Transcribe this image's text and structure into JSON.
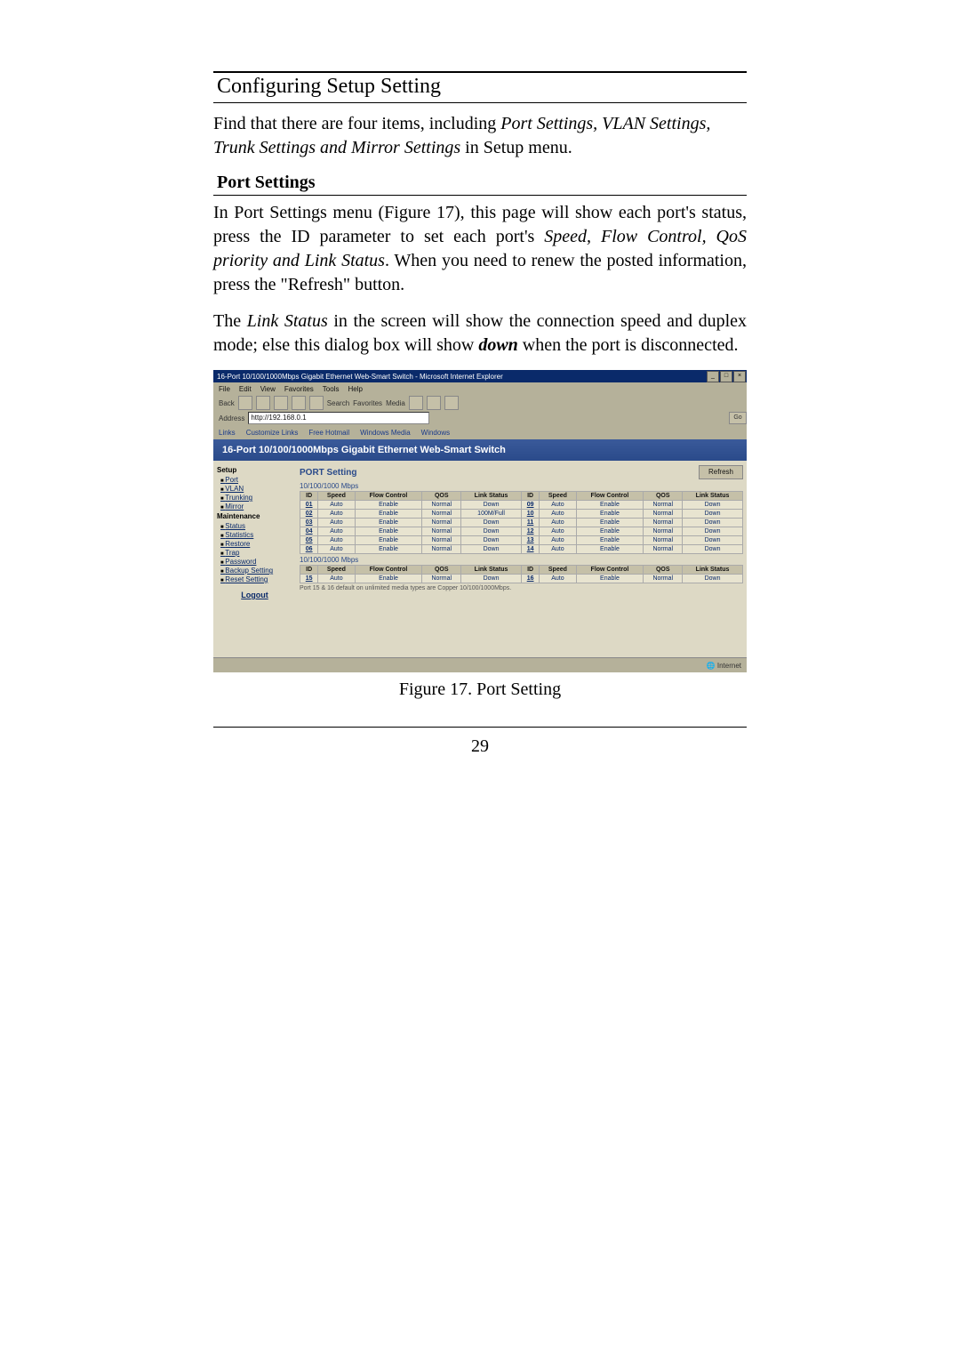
{
  "heading": "Configuring Setup Setting",
  "intro_pre": "Find that there are four items, including ",
  "intro_em": "Port Settings, VLAN Settings, Trunk Settings and Mirror Settings",
  "intro_post": " in Setup menu.",
  "subheading": "Port Settings",
  "para1_a": "In Port Settings menu (Figure 17), this page will show each port's status, press the ID parameter to set each port's ",
  "para1_em": "Speed, Flow Control, QoS priority and Link Status",
  "para1_b": ". When you need to renew the posted information, press the \"Refresh\" button.",
  "para2_a": "The ",
  "para2_em1": "Link Status",
  "para2_b": " in the screen will show the connection speed and duplex mode; else this dialog box will show ",
  "para2_em2": "down",
  "para2_c": " when the port is disconnected.",
  "caption": "Figure 17. Port Setting",
  "pagenum": "29",
  "screenshot": {
    "title": "16-Port 10/100/1000Mbps Gigabit Ethernet Web-Smart Switch - Microsoft Internet Explorer",
    "window_buttons": {
      "min": "_",
      "max": "□",
      "close": "×"
    },
    "menubar": [
      "File",
      "Edit",
      "View",
      "Favorites",
      "Tools",
      "Help"
    ],
    "toolbar_labels": {
      "back": "Back",
      "search": "Search",
      "favorites": "Favorites",
      "media": "Media"
    },
    "address_label": "Address",
    "address_value": "http://192.168.0.1",
    "go": "Go",
    "linksbar": [
      "Links",
      "Customize Links",
      "Free Hotmail",
      "Windows Media",
      "Windows"
    ],
    "header": "16-Port 10/100/1000Mbps Gigabit Ethernet Web-Smart Switch",
    "sidebar_groups": [
      {
        "title": "Setup",
        "items": [
          "Port",
          "VLAN",
          "Trunking",
          "Mirror"
        ]
      },
      {
        "title": "Maintenance",
        "items": [
          "Status",
          "Statistics",
          "Restore",
          "Trap",
          "Password",
          "Backup Setting",
          "Reset Setting"
        ]
      }
    ],
    "logout": "Logout",
    "panel_title": "PORT Setting",
    "refresh": "Refresh",
    "section1": "10/100/1000 Mbps",
    "section2": "10/100/1000 Mbps",
    "table_headers": [
      "ID",
      "Speed",
      "Flow Control",
      "QOS",
      "Link Status"
    ],
    "rows_left": [
      {
        "id": "01",
        "speed": "Auto",
        "flow": "Enable",
        "qos": "Normal",
        "link": "Down"
      },
      {
        "id": "02",
        "speed": "Auto",
        "flow": "Enable",
        "qos": "Normal",
        "link": "100M/Full"
      },
      {
        "id": "03",
        "speed": "Auto",
        "flow": "Enable",
        "qos": "Normal",
        "link": "Down"
      },
      {
        "id": "04",
        "speed": "Auto",
        "flow": "Enable",
        "qos": "Normal",
        "link": "Down"
      },
      {
        "id": "05",
        "speed": "Auto",
        "flow": "Enable",
        "qos": "Normal",
        "link": "Down"
      },
      {
        "id": "06",
        "speed": "Auto",
        "flow": "Enable",
        "qos": "Normal",
        "link": "Down"
      }
    ],
    "rows_right": [
      {
        "id": "09",
        "speed": "Auto",
        "flow": "Enable",
        "qos": "Normal",
        "link": "Down"
      },
      {
        "id": "10",
        "speed": "Auto",
        "flow": "Enable",
        "qos": "Normal",
        "link": "Down"
      },
      {
        "id": "11",
        "speed": "Auto",
        "flow": "Enable",
        "qos": "Normal",
        "link": "Down"
      },
      {
        "id": "12",
        "speed": "Auto",
        "flow": "Enable",
        "qos": "Normal",
        "link": "Down"
      },
      {
        "id": "13",
        "speed": "Auto",
        "flow": "Enable",
        "qos": "Normal",
        "link": "Down"
      },
      {
        "id": "14",
        "speed": "Auto",
        "flow": "Enable",
        "qos": "Normal",
        "link": "Down"
      }
    ],
    "rows2_left": [
      {
        "id": "15",
        "speed": "Auto",
        "flow": "Enable",
        "qos": "Normal",
        "link": "Down"
      }
    ],
    "rows2_right": [
      {
        "id": "16",
        "speed": "Auto",
        "flow": "Enable",
        "qos": "Normal",
        "link": "Down"
      }
    ],
    "footnote": "Port 15 & 16 default on unlimited media types are Copper 10/100/1000Mbps.",
    "status_left": "",
    "status_right": "Internet"
  }
}
